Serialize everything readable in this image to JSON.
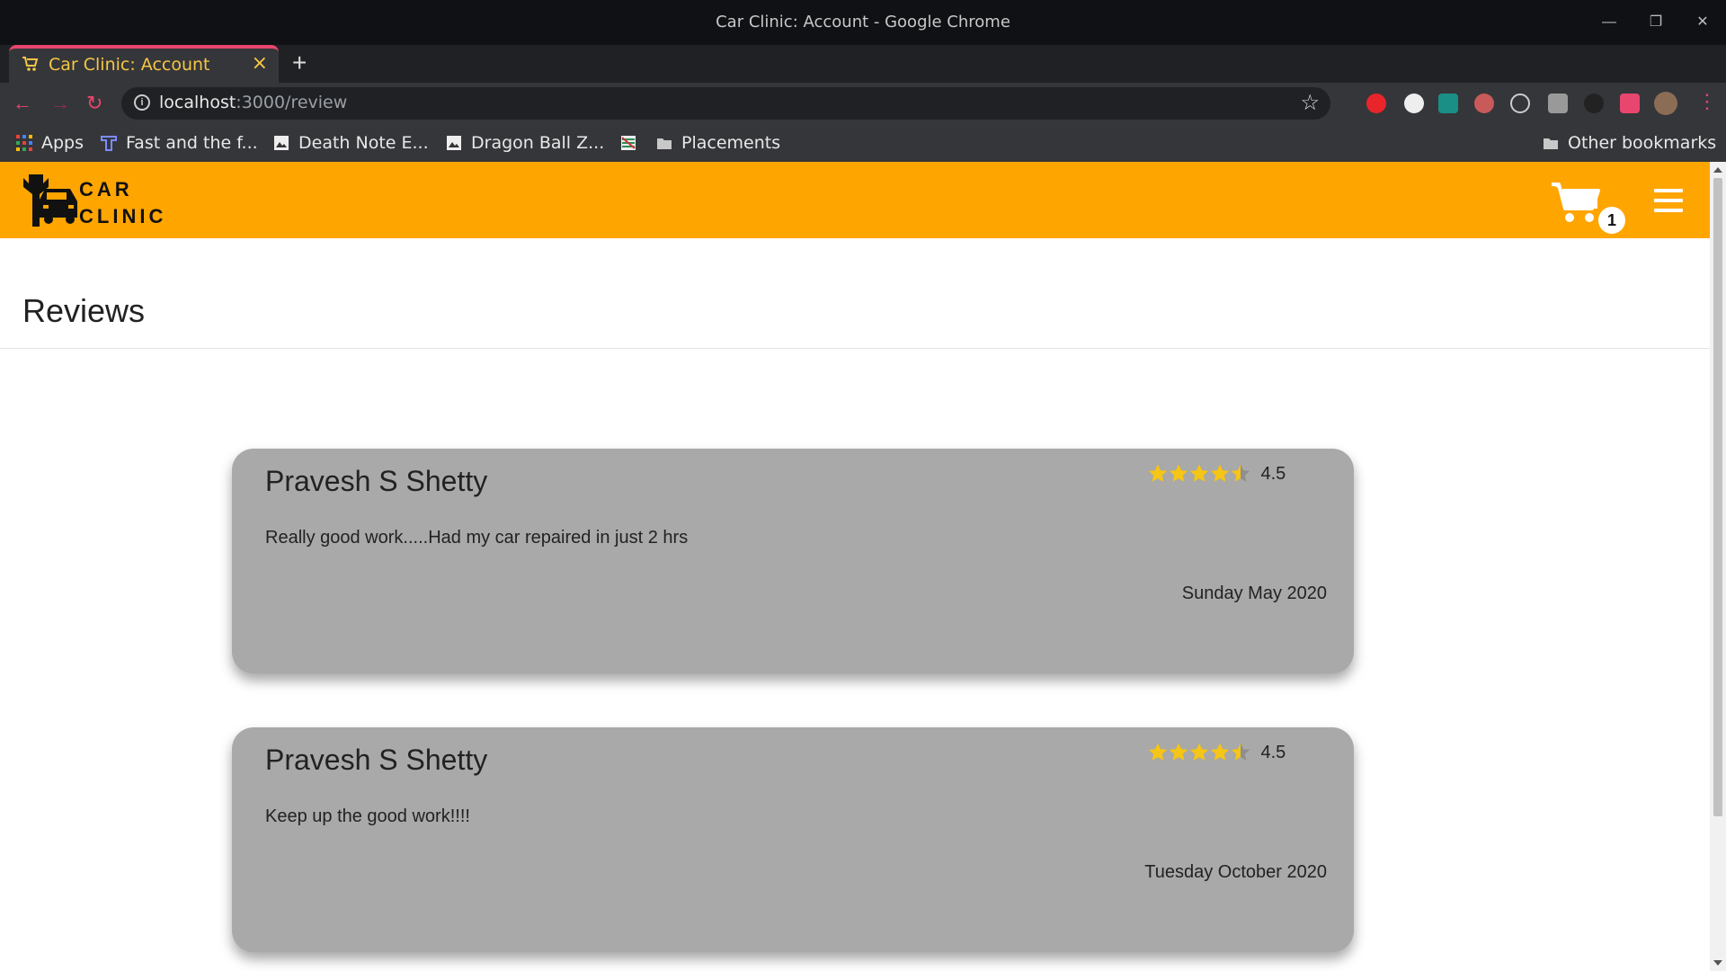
{
  "window": {
    "title": "Car Clinic: Account - Google Chrome"
  },
  "tab": {
    "title": "Car Clinic: Account",
    "close": "×"
  },
  "address": {
    "host": "localhost",
    "path": ":3000/review"
  },
  "bookmarks": [
    {
      "label": "Apps",
      "icon": "apps-grid-icon"
    },
    {
      "label": "Fast and the f...",
      "icon": "t-icon"
    },
    {
      "label": "Death Note E...",
      "icon": "image-icon"
    },
    {
      "label": "Dragon Ball Z...",
      "icon": "image-icon"
    },
    {
      "label": "",
      "icon": "striped-icon"
    },
    {
      "label": "Placements",
      "icon": "folder-icon"
    }
  ],
  "other_bookmarks": "Other bookmarks",
  "site": {
    "logo_line1": "CAR",
    "logo_line2": "CLINIC",
    "cart_count": "1",
    "accent_color": "#ffa500"
  },
  "page_title": "Reviews",
  "reviews": [
    {
      "name": "Pravesh S Shetty",
      "rating": 4.5,
      "rating_label": "4.5",
      "text": "Really good work.....Had my car repaired in just 2 hrs",
      "date": "Sunday May 2020"
    },
    {
      "name": "Pravesh S Shetty",
      "rating": 4.5,
      "rating_label": "4.5",
      "text": "Keep up the good work!!!!",
      "date": "Tuesday October 2020"
    }
  ],
  "colors": {
    "star": "#f5c518",
    "card_bg": "#a9a9a9"
  }
}
